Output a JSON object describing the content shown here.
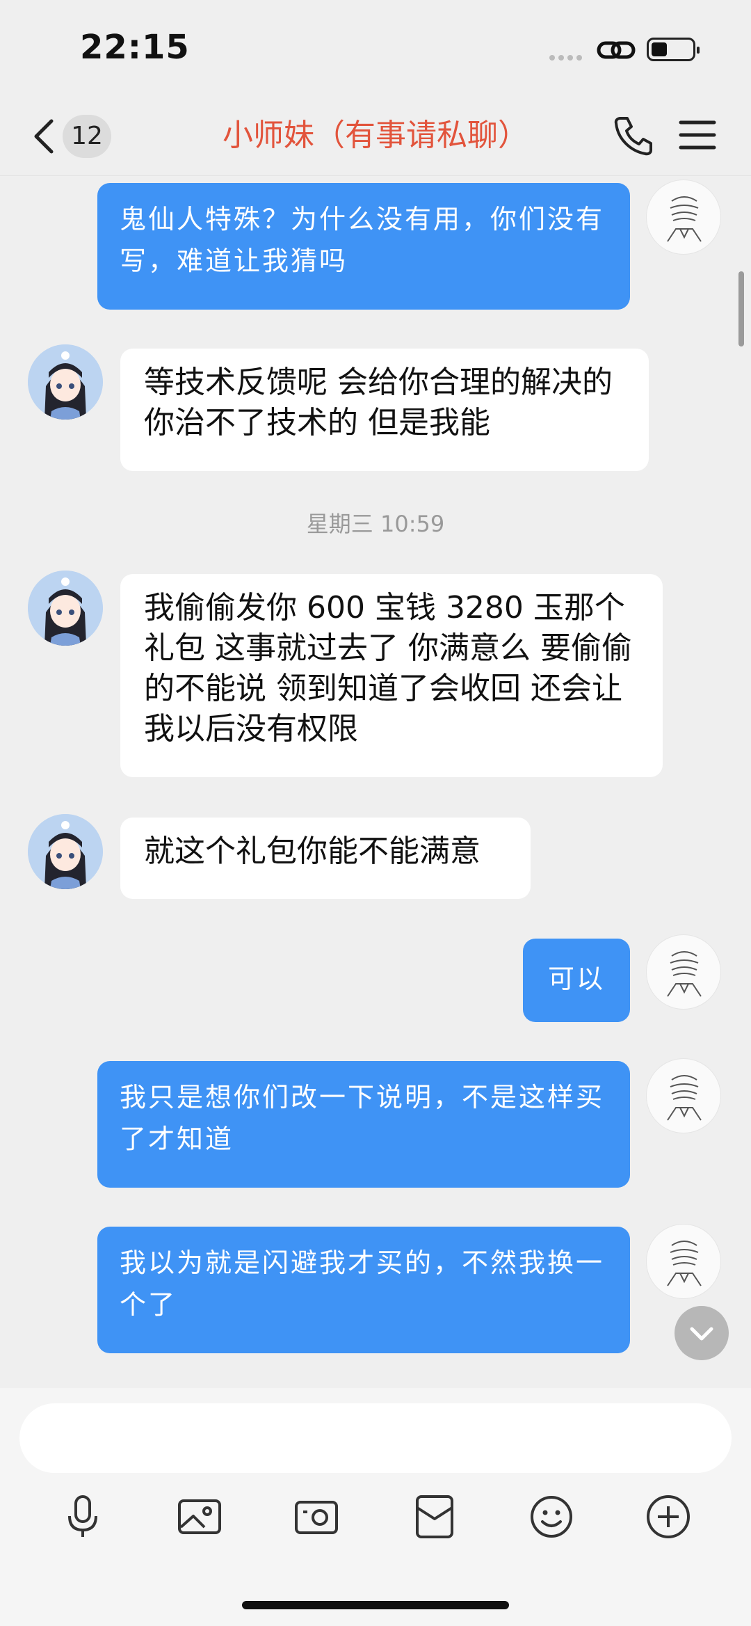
{
  "status_bar": {
    "time": "22:15"
  },
  "header": {
    "unread_count": "12",
    "title": "小师妹（有事请私聊）"
  },
  "messages": [
    {
      "from": "me",
      "text": "鬼仙人特殊？为什么没有用，你们没有写，难道让我猜吗"
    },
    {
      "from": "other",
      "text": "等技术反馈呢  会给你合理的解决的  你治不了技术的  但是我能"
    },
    {
      "from": "other",
      "text": "我偷偷发你 600 宝钱 3280 玉那个礼包 这事就过去了 你满意么  要偷偷的不能说 领到知道了会收回 还会让我以后没有权限"
    },
    {
      "from": "other",
      "text": "就这个礼包你能不能满意"
    },
    {
      "from": "me",
      "text": "可以"
    },
    {
      "from": "me",
      "text": "我只是想你们改一下说明，不是这样买了才知道"
    },
    {
      "from": "me",
      "text": "我以为就是闪避我才买的，不然我换一个了"
    }
  ],
  "timestamp": "星期三 10:59",
  "input": {
    "placeholder": ""
  },
  "colors": {
    "accent": "#3f93f5",
    "title": "#e2543c",
    "background": "#efefef"
  },
  "toolbar": [
    "microphone-icon",
    "image-icon",
    "camera-icon",
    "red-packet-icon",
    "emoji-icon",
    "plus-icon"
  ]
}
